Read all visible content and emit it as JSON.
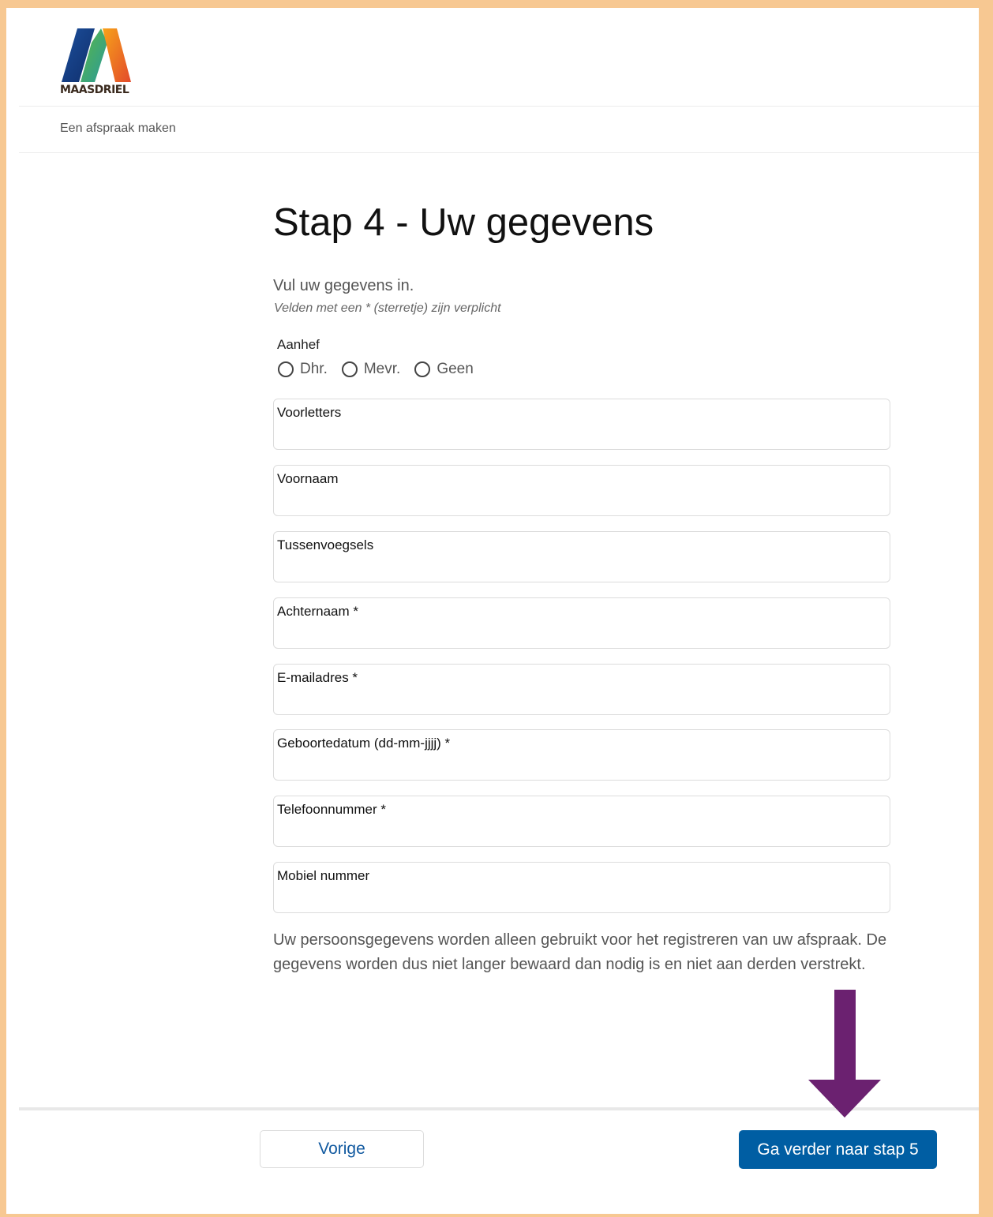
{
  "header": {
    "logo_text": "MAASDRIEL"
  },
  "breadcrumb": "Een afspraak maken",
  "page": {
    "title": "Stap 4 - Uw gegevens",
    "intro": "Vul uw gegevens in.",
    "required_note": "Velden met een * (sterretje) zijn verplicht"
  },
  "aanhef": {
    "label": "Aanhef",
    "options": [
      "Dhr.",
      "Mevr.",
      "Geen"
    ]
  },
  "fields": [
    {
      "label": "Voorletters"
    },
    {
      "label": "Voornaam"
    },
    {
      "label": "Tussenvoegsels"
    },
    {
      "label": "Achternaam *"
    },
    {
      "label": "E-mailadres *"
    },
    {
      "label": "Geboortedatum (dd-mm-jjjj) *"
    },
    {
      "label": "Telefoonnummer *"
    },
    {
      "label": "Mobiel nummer"
    }
  ],
  "privacy_text": "Uw persoonsgegevens worden alleen gebruikt voor het registreren van uw afspraak. De gegevens worden dus niet langer bewaard dan nodig is en niet aan derden verstrekt.",
  "buttons": {
    "previous": "Vorige",
    "next": "Ga verder naar stap 5"
  },
  "colors": {
    "frame": "#f7c892",
    "primary_button": "#005ea3",
    "link_blue": "#125aa0",
    "annotation_arrow": "#6b2170"
  }
}
